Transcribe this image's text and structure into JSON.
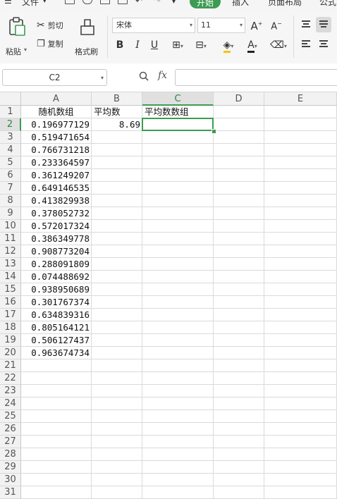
{
  "menu": {
    "file": "文件",
    "tabs": [
      "开始",
      "插入",
      "页面布局",
      "公式"
    ],
    "active_tab": "开始"
  },
  "ribbon": {
    "paste": "粘贴",
    "cut": "剪切",
    "copy": "复制",
    "format_painter": "格式刷",
    "font_name": "宋体",
    "font_size": "11",
    "grow_font": "A⁺",
    "shrink_font": "A⁻",
    "bold": "B",
    "italic": "I",
    "underline": "U",
    "font_color": "A"
  },
  "formula_bar": {
    "name_box": "C2",
    "fx": "fx",
    "formula": ""
  },
  "sheet": {
    "columns": [
      "A",
      "B",
      "C",
      "D",
      "E"
    ],
    "active_column": "C",
    "active_row": 2,
    "headers": {
      "A": "随机数组",
      "B": "平均数",
      "C": "平均数数组"
    },
    "average": "8.69",
    "row_numbers": [
      "1",
      "2",
      "3",
      "4",
      "5",
      "6",
      "7",
      "8",
      "9",
      "10",
      "11",
      "12",
      "13",
      "14",
      "15",
      "16",
      "17",
      "18",
      "19",
      "20",
      "21",
      "22",
      "23",
      "24",
      "25",
      "26",
      "27",
      "28",
      "29",
      "30",
      "31"
    ],
    "col_a_values": [
      "0.196977129",
      "0.519471654",
      "0.766731218",
      "0.233364597",
      "0.361249207",
      "0.649146535",
      "0.413829938",
      "0.378052732",
      "0.572017324",
      "0.386349778",
      "0.908773204",
      "0.288091809",
      "0.074488692",
      "0.938950689",
      "0.301767374",
      "0.634839316",
      "0.805164121",
      "0.506127437",
      "0.963674734"
    ]
  },
  "colors": {
    "accent": "#3c9c52",
    "header_bg": "#f2f2f2",
    "grid_line": "#dadada"
  }
}
